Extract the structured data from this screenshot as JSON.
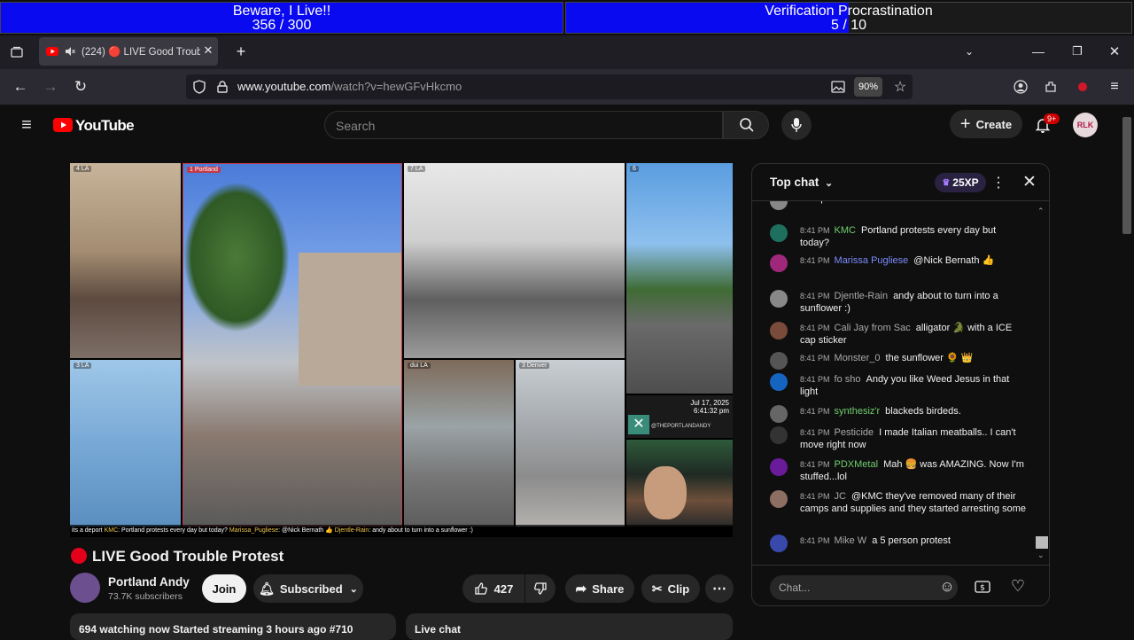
{
  "overlay": {
    "goal1": {
      "title": "Beware, I Live!!",
      "progress": "356 / 300",
      "fill_fraction": 1.0
    },
    "goal2": {
      "title": "Verification Procrastination",
      "progress": "5 / 10",
      "fill_fraction": 0.5
    }
  },
  "browser": {
    "tab_title": "(224) 🔴 LIVE Good Troubl",
    "url_domain": "www.youtube.com",
    "url_path": "/watch?v=hewGFvHkcmo",
    "zoom": "90%"
  },
  "header": {
    "logo_text": "YouTube",
    "search_placeholder": "Search",
    "create_label": "Create",
    "notif_count": "9+",
    "avatar_text": "RLK"
  },
  "video": {
    "cells": [
      {
        "label": "4 LA"
      },
      {
        "label": "1 Portland"
      },
      {
        "label": "7 LA"
      },
      {
        "label": "6"
      },
      {
        "label": "3 LA"
      },
      {
        "label": "dui LA"
      },
      {
        "label": "3 Denver"
      }
    ],
    "watermark_date": "Jul 17, 2025",
    "watermark_time": "6:41:32 pm",
    "watermark_handle": "@THEPORTLANDANDY",
    "ticker": [
      {
        "author": "",
        "text": "its a deport"
      },
      {
        "author": "KMC",
        "text": ": Portland protests every day but today?"
      },
      {
        "author": "Marissa_Pugliese",
        "text": ": @Nick Bernath 👍"
      },
      {
        "author": "Djentle-Rain",
        "text": ": andy about to turn into a sunflower :)"
      }
    ]
  },
  "video_info": {
    "title": "LIVE Good Trouble Protest",
    "channel": "Portland Andy",
    "subscribers": "73.7K subscribers",
    "join_label": "Join",
    "subscribed_label": "Subscribed",
    "likes": "427",
    "share_label": "Share",
    "clip_label": "Clip",
    "stats": "694 watching now  Started streaming 3 hours ago  #710",
    "live_chat_label": "Live chat"
  },
  "chat": {
    "mode_label": "Top chat",
    "xp_label": "25XP",
    "input_placeholder": "Chat...",
    "messages": [
      {
        "time": "",
        "author": "",
        "text": "deport",
        "color": "#888888"
      },
      {
        "time": "8:41 PM",
        "author": "KMC",
        "text": "Portland protests every day but today?",
        "color": "#1f6f5e"
      },
      {
        "time": "8:41 PM",
        "author": "Marissa Pugliese",
        "text": "@Nick Bernath 👍",
        "color": "#a0287a"
      },
      {
        "time": "8:41 PM",
        "author": "Djentle-Rain",
        "text": "andy about to turn into a sunflower :)",
        "color": "#888888"
      },
      {
        "time": "8:41 PM",
        "author": "Cali Jay from Sac",
        "text": "alligator 🐊 with a ICE cap sticker",
        "color": "#7a4b3a"
      },
      {
        "time": "8:41 PM",
        "author": "Monster_0",
        "text": "the sunflower 🌻 👑",
        "color": "#555555"
      },
      {
        "time": "8:41 PM",
        "author": "fo sho",
        "text": "Andy you like Weed Jesus in that light",
        "color": "#1565c0"
      },
      {
        "time": "8:41 PM",
        "author": "synthesiz'r",
        "text": "blackeds birdeds.",
        "color": "#666666"
      },
      {
        "time": "8:41 PM",
        "author": "Pesticide",
        "text": "I made Italian meatballs.. I can't move right now",
        "color": "#333333"
      },
      {
        "time": "8:41 PM",
        "author": "PDXMetal",
        "text": "Mah 🍔 was AMAZING. Now I'm stuffed...lol",
        "color": "#6a1b9a"
      },
      {
        "time": "8:41 PM",
        "author": "JC",
        "text": "@KMC they've removed many of their camps and supplies and they started arresting some",
        "color": "#8d6e63"
      },
      {
        "time": "8:41 PM",
        "author": "Mike W",
        "text": "a 5 person protest",
        "color": "#3949ab"
      }
    ]
  }
}
